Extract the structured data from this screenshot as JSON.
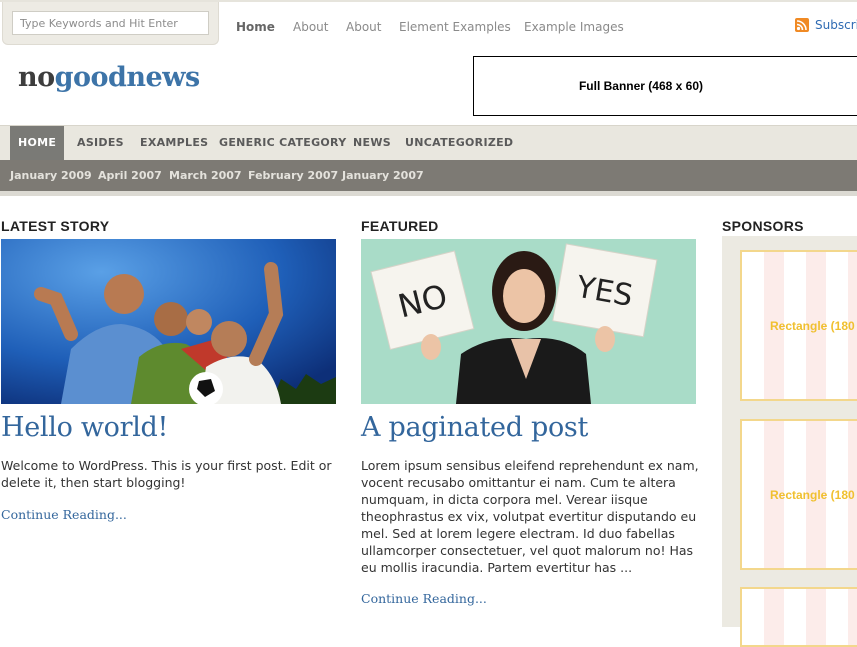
{
  "search": {
    "placeholder": "Type Keywords and Hit Enter"
  },
  "topnav": {
    "items": [
      {
        "label": "Home",
        "active": true
      },
      {
        "label": "About"
      },
      {
        "label": "About"
      },
      {
        "label": "Element Examples"
      },
      {
        "label": "Example Images"
      }
    ],
    "subscribe_label": "Subscri"
  },
  "site": {
    "logo_part1": "no",
    "logo_part2": "goodnews"
  },
  "banner": {
    "label": "Full Banner (468 x 60)"
  },
  "mainnav": {
    "items": [
      {
        "label": "HOME",
        "active": true
      },
      {
        "label": "ASIDES"
      },
      {
        "label": "EXAMPLES"
      },
      {
        "label": "GENERIC CATEGORY"
      },
      {
        "label": "NEWS"
      },
      {
        "label": "UNCATEGORIZED"
      }
    ]
  },
  "archives": {
    "items": [
      {
        "label": "January 2009"
      },
      {
        "label": "April 2007"
      },
      {
        "label": "March 2007"
      },
      {
        "label": "February 2007"
      },
      {
        "label": "January 2007"
      }
    ]
  },
  "latest": {
    "heading": "LATEST STORY",
    "title": "Hello world!",
    "body": "Welcome to WordPress. This is your first post. Edit or delete it, then start blogging!",
    "continue": "Continue Reading..."
  },
  "featured": {
    "heading": "FEATURED",
    "title": "A paginated post",
    "body": "Lorem ipsum sensibus eleifend reprehendunt ex nam, vocent recusabo omittantur ei nam. Cum te altera numquam, in dicta corpora mel. Verear iisque theophrastus ex vix, volutpat evertitur disputando eu mel. Sed at lorem legere electram. Id duo fabellas ullamcorper consectetuer, vel quot malorum no! Has eu mollis iracundia. Partem evertitur has ...",
    "continue": "Continue Reading...",
    "sign_no": "NO",
    "sign_yes": "YES"
  },
  "sponsors": {
    "heading": "SPONSORS",
    "ads": [
      {
        "label": "Rectangle (180"
      },
      {
        "label": "Rectangle (180"
      },
      {
        "label": ""
      }
    ]
  },
  "colors": {
    "accent": "#33669c",
    "logo_dark": "#3d3d3d",
    "logo_blue": "#3d74a8",
    "nav_active": "#7a7a76",
    "subnav_bg": "#7d7a74",
    "rss": "#f08a24"
  }
}
